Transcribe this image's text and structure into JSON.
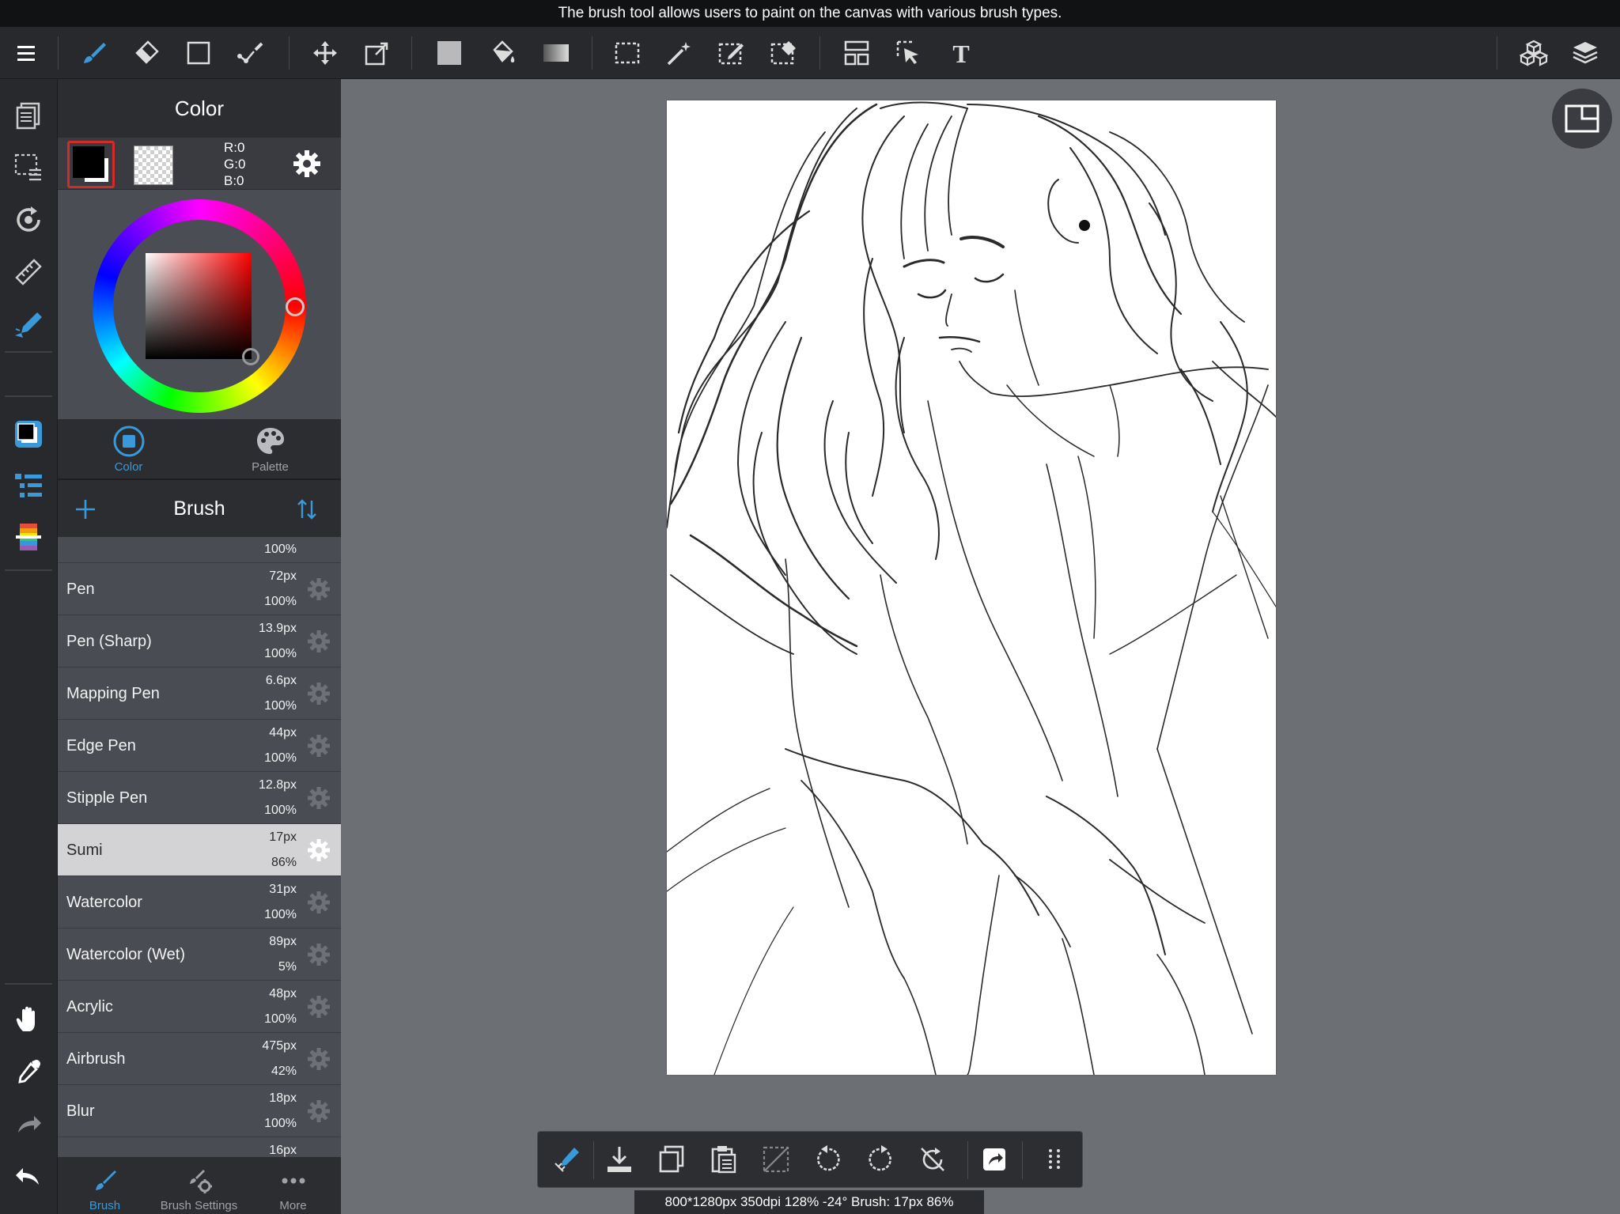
{
  "tooltip": "The brush tool allows users to paint on the canvas with various brush types.",
  "colors": {
    "accent": "#3a9ad9",
    "selected_row": "#d3d3d6",
    "panel": "#4a4c53"
  },
  "color_panel": {
    "title": "Color",
    "rgb": {
      "r": "R:0",
      "g": "G:0",
      "b": "B:0"
    },
    "tabs": [
      {
        "label": "Color",
        "icon": "color-square-icon",
        "active": true
      },
      {
        "label": "Palette",
        "icon": "palette-icon",
        "active": false
      }
    ]
  },
  "brush_panel": {
    "title": "Brush",
    "partial_top": {
      "opacity": "100%"
    },
    "items": [
      {
        "name": "Pen",
        "size": "72px",
        "opacity": "100%"
      },
      {
        "name": "Pen (Sharp)",
        "size": "13.9px",
        "opacity": "100%"
      },
      {
        "name": "Mapping Pen",
        "size": "6.6px",
        "opacity": "100%"
      },
      {
        "name": "Edge Pen",
        "size": "44px",
        "opacity": "100%"
      },
      {
        "name": "Stipple Pen",
        "size": "12.8px",
        "opacity": "100%"
      },
      {
        "name": "Sumi",
        "size": "17px",
        "opacity": "86%",
        "selected": true
      },
      {
        "name": "Watercolor",
        "size": "31px",
        "opacity": "100%"
      },
      {
        "name": "Watercolor (Wet)",
        "size": "89px",
        "opacity": "5%"
      },
      {
        "name": "Acrylic",
        "size": "48px",
        "opacity": "100%"
      },
      {
        "name": "Airbrush",
        "size": "475px",
        "opacity": "42%"
      },
      {
        "name": "Blur",
        "size": "18px",
        "opacity": "100%"
      }
    ],
    "partial_bottom": {
      "size": "16px"
    },
    "tabs": [
      {
        "label": "Brush",
        "icon": "brush-icon",
        "active": true
      },
      {
        "label": "Brush Settings",
        "icon": "brush-settings-icon",
        "active": false
      },
      {
        "label": "More",
        "icon": "more-dots-icon",
        "active": false
      }
    ]
  },
  "status": "800*1280px 350dpi 128% -24° Brush: 17px 86%"
}
